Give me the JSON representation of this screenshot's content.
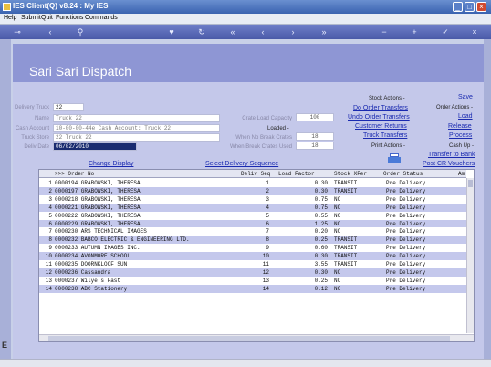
{
  "window": {
    "title": "IES Client(Q) v8.24 : My IES"
  },
  "menu": [
    "Help",
    "Submit",
    "Quit",
    "Functions",
    "Commands"
  ],
  "toolbar_icons": [
    "key-icon",
    "back-icon",
    "search-icon",
    "favorite-icon",
    "refresh-icon",
    "first-icon",
    "prev-icon",
    "next-icon",
    "last-icon",
    "delete-icon",
    "add-icon",
    "accept-icon",
    "cancel-icon"
  ],
  "page": {
    "title": "Sari Sari Dispatch"
  },
  "form": {
    "delivery_truck_label": "Delivery Truck",
    "delivery_truck": "22",
    "name_label": "Name",
    "name": "Truck 22",
    "cash_account_label": "Cash Account",
    "cash_account": "10-00-00-44e Cash Account: Truck 22",
    "truck_store_label": "Truck Store",
    "truck_store": "22 Truck 22",
    "deliv_date_label": "Deliv Date",
    "deliv_date": "06/02/2010",
    "crate_load_capacity_label": "Crate Load Capacity",
    "crate_load_capacity": "100",
    "loaded_label": "Loaded -",
    "when_no_break_label": "When No Break Crates",
    "when_no_break": "18",
    "when_break_label": "When Break Crates Used",
    "when_break": "18"
  },
  "links": {
    "change_display": "Change Display",
    "select_delivery_sequence": "Select Delivery Sequence"
  },
  "stock_actions": {
    "label": "Stock Actions -",
    "items": [
      "Do Order Transfers",
      "Undo Order Transfers",
      "Customer Returns",
      "Truck Transfers"
    ]
  },
  "print_actions": {
    "label": "Print Actions -"
  },
  "order_actions": {
    "save": "Save",
    "label": "Order Actions -",
    "items": [
      "Load",
      "Release",
      "Process"
    ]
  },
  "cash_actions": {
    "label": "Cash Up -",
    "items": [
      "Transfer to Bank",
      "Post CR Vouchers"
    ]
  },
  "grid": {
    "columns": [
      ">>> Order No",
      "Deliv Seq",
      "Load Factor",
      "Stock XFer",
      "Order Status",
      "Am"
    ],
    "rows": [
      {
        "n": "1",
        "order": "0000194 GRABOWSKI, THERESA",
        "seq": "1",
        "load": "0.30",
        "xfer": "TRANSIT",
        "status": "Pre Delivery"
      },
      {
        "n": "2",
        "order": "0000197 GRABOWSKI, THERESA",
        "seq": "2",
        "load": "0.30",
        "xfer": "TRANSIT",
        "status": "Pre Delivery"
      },
      {
        "n": "3",
        "order": "0000218 GRABOWSKI, THERESA",
        "seq": "3",
        "load": "0.75",
        "xfer": "NO",
        "status": "Pre Delivery"
      },
      {
        "n": "4",
        "order": "0000221 GRABOWSKI, THERESA",
        "seq": "4",
        "load": "0.75",
        "xfer": "NO",
        "status": "Pre Delivery"
      },
      {
        "n": "5",
        "order": "0000222 GRABOWSKI, THERESA",
        "seq": "5",
        "load": "0.55",
        "xfer": "NO",
        "status": "Pre Delivery"
      },
      {
        "n": "6",
        "order": "0000229 GRABOWSKI, THERESA",
        "seq": "6",
        "load": "1.25",
        "xfer": "NO",
        "status": "Pre Delivery"
      },
      {
        "n": "7",
        "order": "0000230 ARS TECHNICAL IMAGES",
        "seq": "7",
        "load": "0.20",
        "xfer": "NO",
        "status": "Pre Delivery"
      },
      {
        "n": "8",
        "order": "0000232 BABCO ELECTRIC & ENGINEERING LTD.",
        "seq": "8",
        "load": "0.25",
        "xfer": "TRANSIT",
        "status": "Pre Delivery"
      },
      {
        "n": "9",
        "order": "0000233 AUTUMN IMAGES INC.",
        "seq": "9",
        "load": "0.60",
        "xfer": "TRANSIT",
        "status": "Pre Delivery"
      },
      {
        "n": "10",
        "order": "0000234 AVONMORE SCHOOL",
        "seq": "10",
        "load": "0.30",
        "xfer": "TRANSIT",
        "status": "Pre Delivery"
      },
      {
        "n": "11",
        "order": "0000235 DOORNKLOOF SUN",
        "seq": "11",
        "load": "3.55",
        "xfer": "TRANSIT",
        "status": "Pre Delivery"
      },
      {
        "n": "12",
        "order": "0000236 Cassandra",
        "seq": "12",
        "load": "0.30",
        "xfer": "NO",
        "status": "Pre Delivery"
      },
      {
        "n": "13",
        "order": "0000237 Wilye's Fast",
        "seq": "13",
        "load": "0.25",
        "xfer": "NO",
        "status": "Pre Delivery"
      },
      {
        "n": "14",
        "order": "0000238 ABC Stationery",
        "seq": "14",
        "load": "0.12",
        "xfer": "NO",
        "status": "Pre Delivery"
      }
    ]
  },
  "colors": {
    "header": "#8e96d4",
    "panel": "#c4c8ea",
    "link": "#1a2ab0",
    "date_field": "#1a2c70"
  }
}
